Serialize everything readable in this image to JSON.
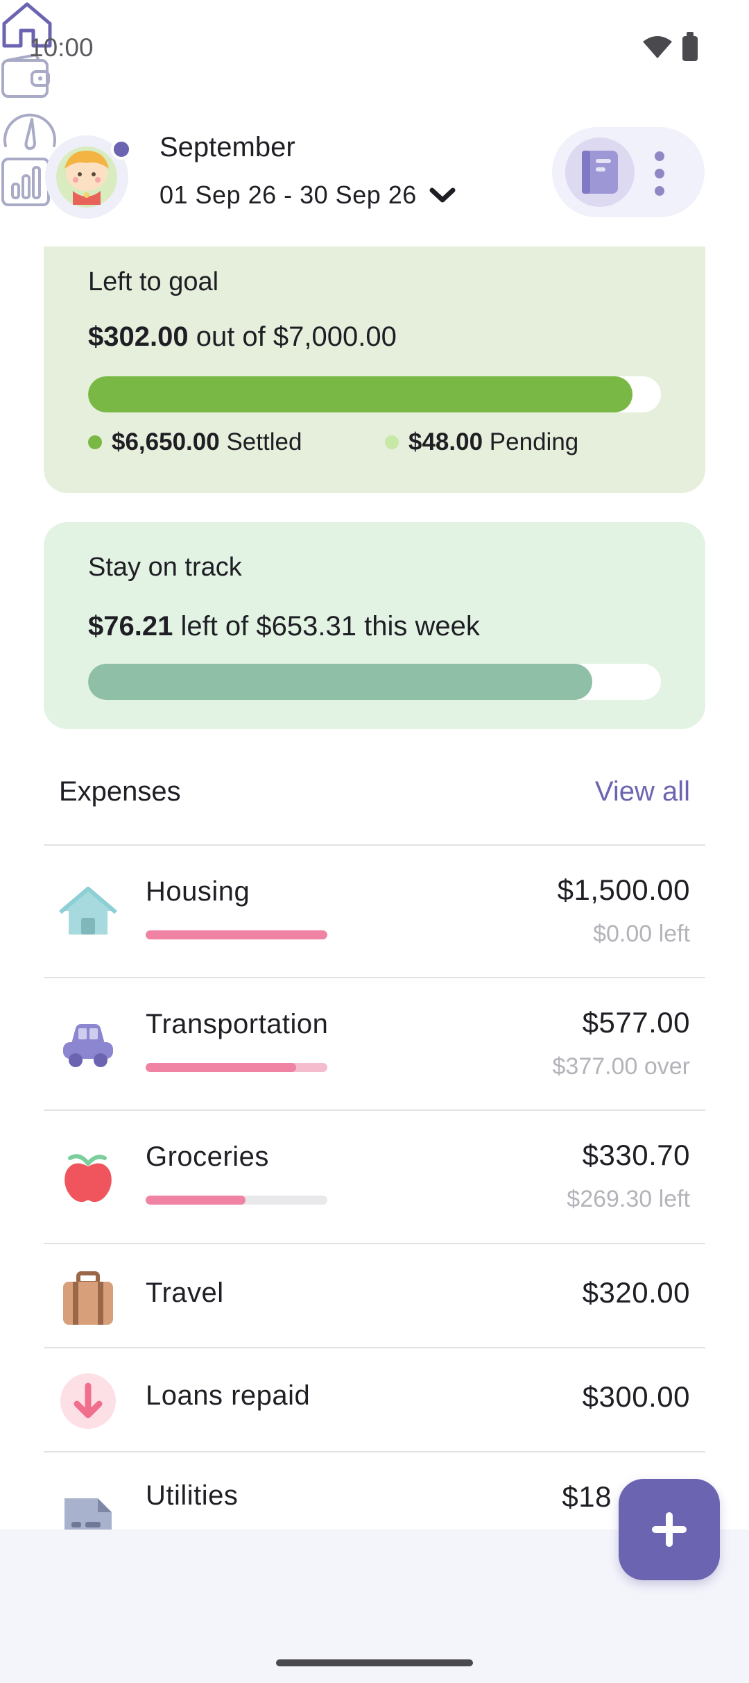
{
  "status_bar": {
    "time": "10:00"
  },
  "header": {
    "month": "September",
    "date_range": "01 Sep 26 - 30 Sep 26"
  },
  "goal_card": {
    "title": "Left to goal",
    "amount": "$302.00",
    "amount_suffix": " out of $7,000.00",
    "progress": 0.95,
    "settled_amount": "$6,650.00",
    "settled_label": "Settled",
    "pending_amount": "$48.00",
    "pending_label": "Pending",
    "colors": {
      "fill": "#7ab846",
      "settled_dot": "#7ab846",
      "pending_dot": "#c7e8a6"
    }
  },
  "track_card": {
    "title": "Stay on track",
    "amount": "$76.21",
    "amount_suffix": " left of $653.31 this week",
    "progress": 0.88,
    "colors": {
      "fill": "#8fbfa6"
    }
  },
  "expenses": {
    "heading": "Expenses",
    "view_all": "View all",
    "items": [
      {
        "name": "Housing",
        "amount": "$1,500.00",
        "note": "$0.00 left",
        "progress": 1.0,
        "icon": "house-icon"
      },
      {
        "name": "Transportation",
        "amount": "$577.00",
        "note": "$377.00 over",
        "progress": 0.83,
        "icon": "car-icon"
      },
      {
        "name": "Groceries",
        "amount": "$330.70",
        "note": "$269.30 left",
        "progress": 0.55,
        "icon": "apple-icon"
      },
      {
        "name": "Travel",
        "amount": "$320.00",
        "icon": "suitcase-icon"
      },
      {
        "name": "Loans repaid",
        "amount": "$300.00",
        "icon": "arrow-down-icon"
      },
      {
        "name": "Utilities",
        "amount": "$18",
        "icon": "document-icon"
      }
    ]
  },
  "nav": {
    "tabs": [
      "home-icon",
      "wallet-icon",
      "gauge-icon",
      "bar-chart-icon"
    ],
    "accent": "#6b64b0"
  },
  "fab": {
    "icon": "plus-icon"
  }
}
